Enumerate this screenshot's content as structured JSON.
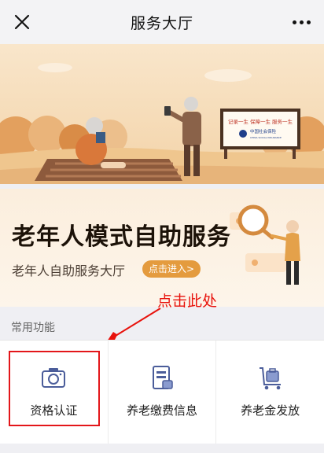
{
  "header": {
    "title": "服务大厅",
    "close_icon": "close-icon",
    "more_icon": "more-dots-icon"
  },
  "banner": {
    "sign_line": "记录一生  保障一生  服务一生",
    "sign_logo_text": "中国社会保险",
    "sign_logo_en": "CHINA SOCIAL INSURANCE",
    "colors": {
      "sky": "#f6dcb8",
      "ground": "#e6b97f",
      "accent": "#d9783a"
    }
  },
  "promo": {
    "headline": "老年人模式自助服务",
    "subtitle": "老年人自助服务大厅",
    "enter_button": "点击进入>",
    "accent": "#e49b3e"
  },
  "annotation": {
    "text": "点击此处",
    "color": "#e8120c"
  },
  "common_functions": {
    "label": "常用功能",
    "items": [
      {
        "label": "资格认证",
        "icon": "camera-icon"
      },
      {
        "label": "养老缴费信息",
        "icon": "document-card-icon"
      },
      {
        "label": "养老金发放",
        "icon": "luggage-cart-icon"
      }
    ],
    "icon_color": "#4b5d9a"
  }
}
